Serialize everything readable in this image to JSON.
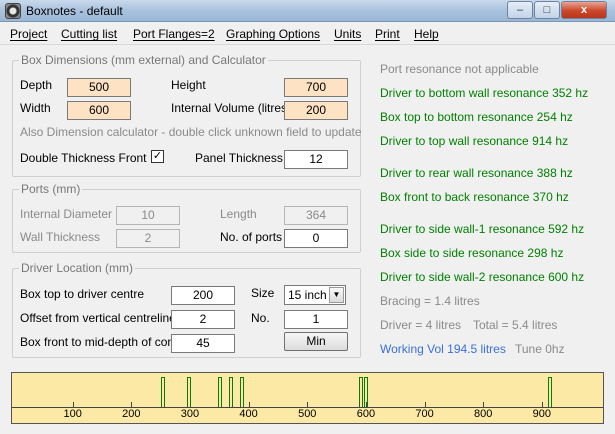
{
  "window": {
    "title": "Boxnotes - default",
    "min_glyph": "–",
    "max_glyph": "□",
    "close_glyph": "x"
  },
  "menu": [
    "Project",
    "Cutting list",
    "Port Flanges=2",
    "Graphing Options",
    "Units",
    "Print",
    "Help"
  ],
  "box": {
    "group_title": "Box Dimensions (mm external) and Calculator",
    "depth_label": "Depth",
    "depth": "500",
    "height_label": "Height",
    "height": "700",
    "width_label": "Width",
    "width": "600",
    "volume_label": "Internal Volume (litres)",
    "volume": "200",
    "calc_note": "Also Dimension calculator - double click unknown field to update",
    "double_thickness_label": "Double Thickness Front",
    "double_thickness_checked": "✓",
    "panel_thickness_label": "Panel Thickness",
    "panel_thickness": "12"
  },
  "ports": {
    "group_title": "Ports (mm)",
    "internal_diameter_label": "Internal Diameter",
    "internal_diameter": "10",
    "length_label": "Length",
    "length": "364",
    "wall_thickness_label": "Wall Thickness",
    "wall_thickness": "2",
    "num_ports_label": "No. of ports",
    "num_ports": "0"
  },
  "driver": {
    "group_title": "Driver Location (mm)",
    "top_label": "Box top to driver centre",
    "top": "200",
    "size_label": "Size",
    "size": "15 inch",
    "offset_label": "Offset from vertical centreline",
    "offset": "2",
    "no_label": "No.",
    "no": "1",
    "front_label": "Box front to mid-depth of cone",
    "front": "45",
    "min_button": "Min"
  },
  "results": {
    "port_resonance": "Port resonance not applicable",
    "driver_bottom": "Driver to bottom wall resonance  352 hz",
    "top_bottom": "Box top to bottom resonance  254 hz",
    "driver_top": "Driver to top wall resonance  914 hz",
    "driver_rear": "Driver to rear wall resonance 388 hz",
    "front_back": "Box front to back resonance  370 hz",
    "driver_side1": "Driver to side wall-1 resonance  592 hz",
    "side_side": "Box side to side resonance  298 hz",
    "driver_side2": "Driver to side wall-2 resonance  600 hz",
    "bracing": "Bracing = 1.4 litres",
    "driver_vol": "Driver =  4 litres",
    "total_vol": "Total =  5.4 litres",
    "working_vol": "Working Vol  194.5 litres",
    "tune": "Tune  0hz"
  },
  "colors": {
    "result_green": "#008000",
    "working_blue": "#3a6fd8",
    "graph_bg": "#fde9a6",
    "field_peach": "#fde2c4"
  },
  "chart_data": {
    "type": "bar",
    "title": "",
    "xlabel": "",
    "xlim": [
      0,
      1000
    ],
    "ticks": [
      100,
      200,
      300,
      400,
      500,
      600,
      700,
      800,
      900
    ],
    "peaks_hz": [
      254,
      298,
      352,
      370,
      388,
      592,
      600,
      914
    ]
  }
}
